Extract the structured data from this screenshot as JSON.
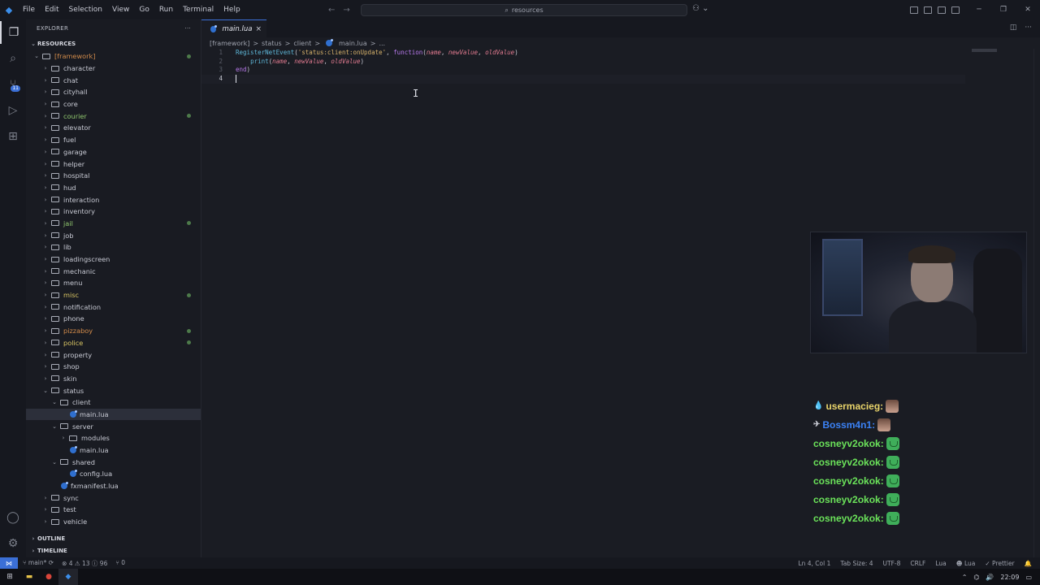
{
  "menu": [
    "File",
    "Edit",
    "Selection",
    "View",
    "Go",
    "Run",
    "Terminal",
    "Help"
  ],
  "search": {
    "text": "resources"
  },
  "sidebar": {
    "title": "EXPLORER",
    "section": "RESOURCES",
    "outline": "OUTLINE",
    "timeline": "TIMELINE"
  },
  "tree": [
    {
      "label": "[framework]",
      "depth": 0,
      "type": "folder",
      "open": true,
      "color": "framework",
      "dot": true
    },
    {
      "label": "character",
      "depth": 1,
      "type": "folder"
    },
    {
      "label": "chat",
      "depth": 1,
      "type": "folder"
    },
    {
      "label": "cityhall",
      "depth": 1,
      "type": "folder"
    },
    {
      "label": "core",
      "depth": 1,
      "type": "folder"
    },
    {
      "label": "courier",
      "depth": 1,
      "type": "folder",
      "color": "green",
      "dot": true
    },
    {
      "label": "elevator",
      "depth": 1,
      "type": "folder"
    },
    {
      "label": "fuel",
      "depth": 1,
      "type": "folder"
    },
    {
      "label": "garage",
      "depth": 1,
      "type": "folder"
    },
    {
      "label": "helper",
      "depth": 1,
      "type": "folder"
    },
    {
      "label": "hospital",
      "depth": 1,
      "type": "folder"
    },
    {
      "label": "hud",
      "depth": 1,
      "type": "folder"
    },
    {
      "label": "interaction",
      "depth": 1,
      "type": "folder"
    },
    {
      "label": "inventory",
      "depth": 1,
      "type": "folder"
    },
    {
      "label": "jail",
      "depth": 1,
      "type": "folder",
      "color": "green",
      "dot": true
    },
    {
      "label": "job",
      "depth": 1,
      "type": "folder"
    },
    {
      "label": "lib",
      "depth": 1,
      "type": "folder"
    },
    {
      "label": "loadingscreen",
      "depth": 1,
      "type": "folder"
    },
    {
      "label": "mechanic",
      "depth": 1,
      "type": "folder"
    },
    {
      "label": "menu",
      "depth": 1,
      "type": "folder"
    },
    {
      "label": "misc",
      "depth": 1,
      "type": "folder",
      "color": "yellow",
      "dot": true
    },
    {
      "label": "notification",
      "depth": 1,
      "type": "folder"
    },
    {
      "label": "phone",
      "depth": 1,
      "type": "folder"
    },
    {
      "label": "pizzaboy",
      "depth": 1,
      "type": "folder",
      "color": "orange",
      "dot": true
    },
    {
      "label": "police",
      "depth": 1,
      "type": "folder",
      "color": "yellow",
      "dot": true
    },
    {
      "label": "property",
      "depth": 1,
      "type": "folder"
    },
    {
      "label": "shop",
      "depth": 1,
      "type": "folder"
    },
    {
      "label": "skin",
      "depth": 1,
      "type": "folder"
    },
    {
      "label": "status",
      "depth": 1,
      "type": "folder",
      "open": true
    },
    {
      "label": "client",
      "depth": 2,
      "type": "folder",
      "open": true
    },
    {
      "label": "main.lua",
      "depth": 3,
      "type": "lua",
      "selected": true
    },
    {
      "label": "server",
      "depth": 2,
      "type": "folder",
      "open": true
    },
    {
      "label": "modules",
      "depth": 3,
      "type": "folder"
    },
    {
      "label": "main.lua",
      "depth": 3,
      "type": "lua"
    },
    {
      "label": "shared",
      "depth": 2,
      "type": "folder",
      "open": true
    },
    {
      "label": "config.lua",
      "depth": 3,
      "type": "lua"
    },
    {
      "label": "fxmanifest.lua",
      "depth": 2,
      "type": "lua"
    },
    {
      "label": "sync",
      "depth": 1,
      "type": "folder"
    },
    {
      "label": "test",
      "depth": 1,
      "type": "folder"
    },
    {
      "label": "vehicle",
      "depth": 1,
      "type": "folder"
    }
  ],
  "tab": {
    "label": "main.lua",
    "close": "×"
  },
  "breadcrumb": [
    "[framework]",
    ">",
    "status",
    ">",
    "client",
    ">",
    "main.lua",
    ">",
    "..."
  ],
  "code": {
    "line_numbers": [
      "1",
      "2",
      "3",
      "4"
    ],
    "line1": {
      "fn": "RegisterNetEvent",
      "open": "(",
      "str": "'status:client:onUpdate'",
      "comma": ", ",
      "kw": "function",
      "p_open": "(",
      "p1": "name",
      "sep1": ", ",
      "p2": "newValue",
      "sep2": ", ",
      "p3": "oldValue",
      "close": ")"
    },
    "line2": {
      "indent": "    ",
      "fn": "print",
      "open": "(",
      "p1": "name",
      "sep1": ", ",
      "p2": "newValue",
      "sep2": ", ",
      "p3": "oldValue",
      "close": ")"
    },
    "line3": {
      "kw": "end",
      "close": ")"
    }
  },
  "chat": [
    {
      "badge": "💧",
      "user": "usermacieg:",
      "color": "#e8d36a",
      "emote": "face"
    },
    {
      "badge": "✈",
      "user": "Bossm4n1:",
      "color": "#3b82f6",
      "emote": "face"
    },
    {
      "badge": "",
      "user": "cosneyv2okok:",
      "color": "#6be35a",
      "emote": "green"
    },
    {
      "badge": "",
      "user": "cosneyv2okok:",
      "color": "#6be35a",
      "emote": "green"
    },
    {
      "badge": "",
      "user": "cosneyv2okok:",
      "color": "#6be35a",
      "emote": "green"
    },
    {
      "badge": "",
      "user": "cosneyv2okok:",
      "color": "#6be35a",
      "emote": "green"
    },
    {
      "badge": "",
      "user": "cosneyv2okok:",
      "color": "#6be35a",
      "emote": "green"
    }
  ],
  "status": {
    "branch": "main*",
    "problems": "⊗ 4 ⚠ 13 ⓘ 96",
    "ports": "⑂ 0",
    "position": "Ln 4, Col 1",
    "tab_size": "Tab Size: 4",
    "encoding": "UTF-8",
    "eol": "CRLF",
    "language": "Lua",
    "lua_ext": "Lua",
    "prettier": "✓ Prettier"
  },
  "taskbar": {
    "time": "22:09"
  },
  "activity_badge": "11",
  "colors": {
    "accent": "#3b6fd6",
    "background": "#1a1c23"
  }
}
